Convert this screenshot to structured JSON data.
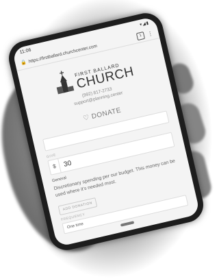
{
  "status": {
    "time": "11:06"
  },
  "browser": {
    "url": "https://firstballard.churchcenter.com",
    "tab_count": "1"
  },
  "church": {
    "name_top": "FIRST BALLARD",
    "name_main": "CHURCH",
    "phone": "(992) 817-2733",
    "email": "support@planning.center"
  },
  "donate": {
    "title": "DONATE",
    "give_label": "GIVE",
    "currency": "$",
    "amount": "30",
    "fund_name": "General",
    "fund_description": "Discretionary spending per our budget. This money can be used where it's needed most.",
    "add_donation": "ADD DONATION",
    "frequency_label": "FREQUENCY",
    "frequency_value": "One time"
  }
}
